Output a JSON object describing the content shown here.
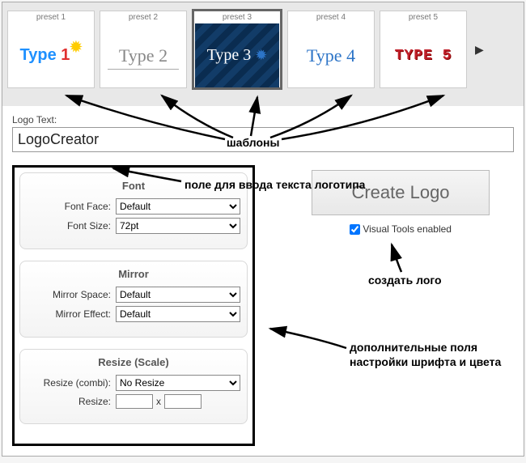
{
  "presets": {
    "items": [
      {
        "label": "preset 1",
        "sample": "Type 1"
      },
      {
        "label": "preset 2",
        "sample": "Type 2"
      },
      {
        "label": "preset 3",
        "sample": "Type 3"
      },
      {
        "label": "preset 4",
        "sample": "Type 4"
      },
      {
        "label": "preset 5",
        "sample": "TYPE 5"
      }
    ],
    "next_glyph": "▶"
  },
  "logoText": {
    "label": "Logo Text:",
    "value": "LogoCreator"
  },
  "panels": {
    "font": {
      "title": "Font",
      "faceLabel": "Font Face:",
      "faceValue": "Default",
      "sizeLabel": "Font Size:",
      "sizeValue": "72pt"
    },
    "mirror": {
      "title": "Mirror",
      "spaceLabel": "Mirror Space:",
      "spaceValue": "Default",
      "effectLabel": "Mirror Effect:",
      "effectValue": "Default"
    },
    "resize": {
      "title": "Resize (Scale)",
      "combiLabel": "Resize (combi):",
      "combiValue": "No Resize",
      "resizeLabel": "Resize:",
      "sep": "x"
    }
  },
  "createBtn": "Create Logo",
  "visualTools": {
    "label": "Visual Tools enabled",
    "checked": true
  },
  "annotations": {
    "templates": "шаблоны",
    "textField": "поле для ввода текста логотипа",
    "createLogo": "создать лого",
    "extraFields": "дополнительные поля настройки шрифта и цвета"
  }
}
